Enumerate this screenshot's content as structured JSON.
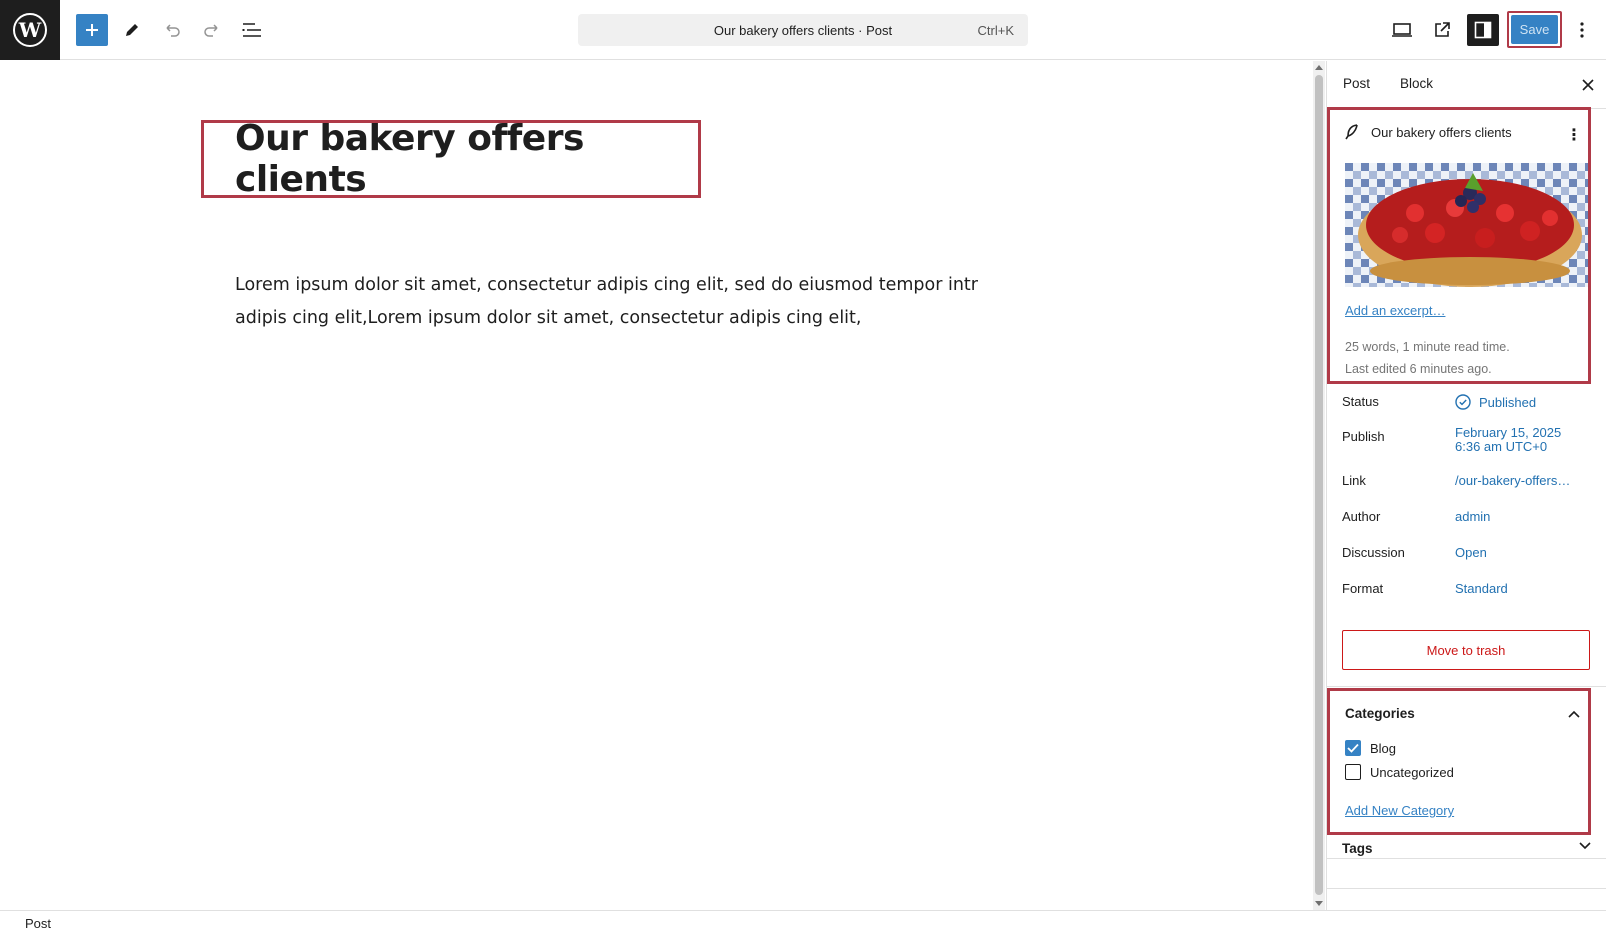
{
  "topbar": {
    "command_title": "Our bakery offers clients · Post",
    "shortcut": "Ctrl+K",
    "save_label": "Save"
  },
  "editor": {
    "post_title": "Our bakery offers clients",
    "paragraph": "Lorem ipsum dolor sit amet, consectetur adipis cing elit, sed do eiusmod tempor intr adipis cing elit,Lorem ipsum dolor sit amet, consectetur adipis cing elit,"
  },
  "sidebar": {
    "tabs": {
      "post": "Post",
      "block": "Block"
    },
    "summary": {
      "title": "Our bakery offers clients",
      "excerpt_link": "Add an excerpt…",
      "word_count": "25 words, 1 minute read time.",
      "last_edited": "Last edited 6 minutes ago."
    },
    "fields": {
      "status_label": "Status",
      "status_value": "Published",
      "publish_label": "Publish",
      "publish_date": "February 15, 2025",
      "publish_time": "6:36 am UTC+0",
      "link_label": "Link",
      "link_value": "/our-bakery-offers…",
      "author_label": "Author",
      "author_value": "admin",
      "discussion_label": "Discussion",
      "discussion_value": "Open",
      "format_label": "Format",
      "format_value": "Standard"
    },
    "trash_label": "Move to trash",
    "categories": {
      "heading": "Categories",
      "items": [
        {
          "label": "Blog",
          "checked": true
        },
        {
          "label": "Uncategorized",
          "checked": false
        }
      ],
      "add_link": "Add New Category"
    },
    "tags_heading": "Tags"
  },
  "footer": {
    "breadcrumb": "Post"
  },
  "colors": {
    "accent": "#3582c4",
    "highlight": "#b03a48",
    "danger": "#cc1818"
  }
}
